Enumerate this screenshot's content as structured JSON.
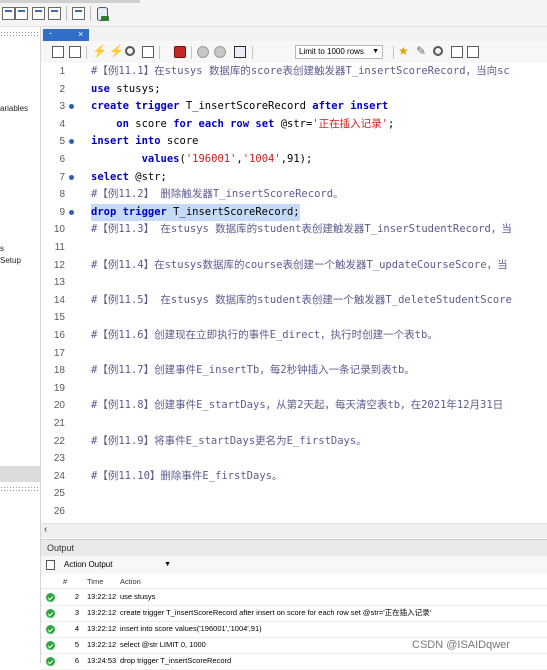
{
  "left_panel": {
    "labels": [
      "ariables",
      "s",
      "Setup"
    ]
  },
  "editor": {
    "tab_label": "-",
    "tab_close": "×",
    "limit_label": "Limit to 1000 rows",
    "lines": [
      {
        "n": "1",
        "fold": false,
        "segments": [
          [
            "cmt",
            "#【例11.1】在stusys 数据库的score表创建触发器T_insertScoreRecord，当向sc"
          ]
        ]
      },
      {
        "n": "2",
        "fold": false,
        "segments": [
          [
            "kw",
            "use"
          ],
          [
            "txt",
            " stusys;"
          ]
        ]
      },
      {
        "n": "3",
        "fold": true,
        "segments": [
          [
            "kw",
            "create trigger"
          ],
          [
            "txt",
            " T_insertScoreRecord "
          ],
          [
            "kw",
            "after insert"
          ]
        ]
      },
      {
        "n": "4",
        "fold": false,
        "segments": [
          [
            "txt",
            "    "
          ],
          [
            "kw",
            "on"
          ],
          [
            "txt",
            " score "
          ],
          [
            "kw",
            "for each row set"
          ],
          [
            "txt",
            " @str="
          ],
          [
            "str",
            "'正在插入记录'"
          ],
          [
            "txt",
            ";"
          ]
        ]
      },
      {
        "n": "5",
        "fold": true,
        "segments": [
          [
            "kw",
            "insert into"
          ],
          [
            "txt",
            " score"
          ]
        ]
      },
      {
        "n": "6",
        "fold": false,
        "segments": [
          [
            "txt",
            "        "
          ],
          [
            "kw",
            "values"
          ],
          [
            "txt",
            "("
          ],
          [
            "str",
            "'196001'"
          ],
          [
            "txt",
            ","
          ],
          [
            "str",
            "'1004'"
          ],
          [
            "txt",
            ",91);"
          ]
        ]
      },
      {
        "n": "7",
        "fold": true,
        "segments": [
          [
            "kw",
            "select"
          ],
          [
            "txt",
            " @str;"
          ]
        ]
      },
      {
        "n": "8",
        "fold": false,
        "segments": [
          [
            "cmt",
            "#【例11.2】 删除触发器T_insertScoreRecord。"
          ]
        ]
      },
      {
        "n": "9",
        "fold": true,
        "selected": true,
        "segments": [
          [
            "kw",
            "drop trigger"
          ],
          [
            "txt",
            " T_insertScoreRecord;"
          ]
        ]
      },
      {
        "n": "10",
        "fold": false,
        "segments": [
          [
            "cmt",
            "#【例11.3】 在stusys 数据库的student表创建触发器T_inserStudentRecord，当"
          ]
        ]
      },
      {
        "n": "11",
        "fold": false,
        "segments": []
      },
      {
        "n": "12",
        "fold": false,
        "segments": [
          [
            "cmt",
            "#【例11.4】在stusys数据库的course表创建一个触发器T_updateCourseScore，当"
          ]
        ]
      },
      {
        "n": "13",
        "fold": false,
        "segments": []
      },
      {
        "n": "14",
        "fold": false,
        "segments": [
          [
            "cmt",
            "#【例11.5】 在stusys 数据库的student表创建一个触发器T_deleteStudentScore"
          ]
        ]
      },
      {
        "n": "15",
        "fold": false,
        "segments": []
      },
      {
        "n": "16",
        "fold": false,
        "segments": [
          [
            "cmt",
            "#【例11.6】创建现在立即执行的事件E_direct，执行时创建一个表tb。"
          ]
        ]
      },
      {
        "n": "17",
        "fold": false,
        "segments": []
      },
      {
        "n": "18",
        "fold": false,
        "segments": [
          [
            "cmt",
            "#【例11.7】创建事件E_insertTb，每2秒钟插入一条记录到表tb。"
          ]
        ]
      },
      {
        "n": "19",
        "fold": false,
        "segments": []
      },
      {
        "n": "20",
        "fold": false,
        "segments": [
          [
            "cmt",
            "#【例11.8】创建事件E_startDays，从第2天起，每天清空表tb，在2021年12月31日"
          ]
        ]
      },
      {
        "n": "21",
        "fold": false,
        "segments": []
      },
      {
        "n": "22",
        "fold": false,
        "segments": [
          [
            "cmt",
            "#【例11.9】将事件E_startDays更名为E_firstDays。"
          ]
        ]
      },
      {
        "n": "23",
        "fold": false,
        "segments": []
      },
      {
        "n": "24",
        "fold": false,
        "segments": [
          [
            "cmt",
            "#【例11.10】删除事件E_firstDays。"
          ]
        ]
      },
      {
        "n": "25",
        "fold": false,
        "segments": []
      },
      {
        "n": "26",
        "fold": false,
        "segments": []
      }
    ]
  },
  "output": {
    "title": "Output",
    "mode": "Action Output",
    "columns": {
      "num": "#",
      "time": "Time",
      "action": "Action"
    },
    "rows": [
      {
        "num": "2",
        "time": "13:22:12",
        "action": "use stusys"
      },
      {
        "num": "3",
        "time": "13:22:12",
        "action": "create trigger T_insertScoreRecord after insert on score for each row set @str='正在插入记录'"
      },
      {
        "num": "4",
        "time": "13:22:12",
        "action": "insert into score values('196001','1004',91)"
      },
      {
        "num": "5",
        "time": "13:22:12",
        "action": "select @str LIMIT 0, 1000"
      },
      {
        "num": "6",
        "time": "13:24:53",
        "action": "drop trigger T_insertScoreRecord"
      }
    ]
  },
  "watermark": "CSDN @ISAIDqwer"
}
